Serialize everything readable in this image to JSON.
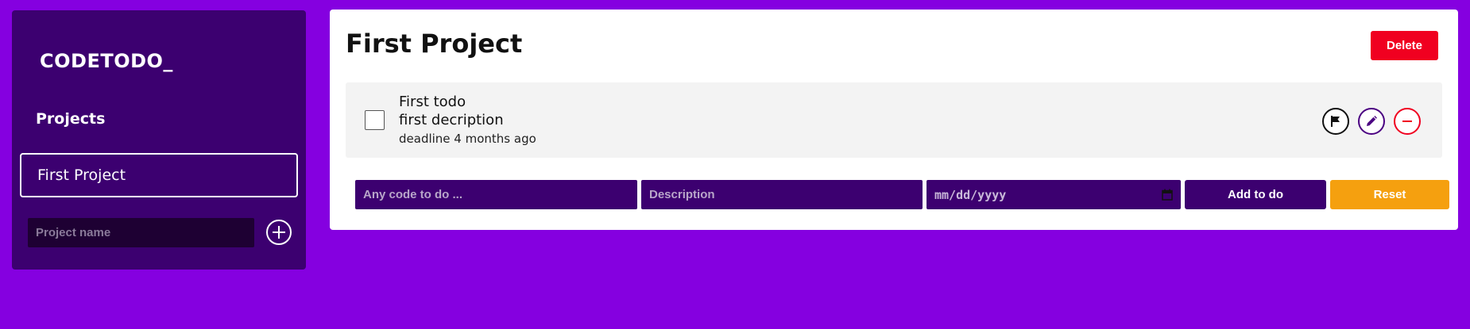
{
  "sidebar": {
    "logo": "CODETODO_",
    "projects_heading": "Projects",
    "projects": [
      {
        "label": "First Project"
      }
    ],
    "new_project_placeholder": "Project name",
    "add_icon": "plus-circle-icon"
  },
  "main": {
    "title": "First Project",
    "delete_label": "Delete",
    "todos": [
      {
        "title": "First todo",
        "description": "first decription",
        "deadline": "deadline 4 months ago",
        "checked": false,
        "actions": [
          "flag-icon",
          "pencil-icon",
          "minus-circle-icon"
        ]
      }
    ],
    "form": {
      "code_placeholder": "Any code to do ...",
      "description_placeholder": "Description",
      "date_placeholder": "mm/dd/yyyy",
      "add_label": "Add to do",
      "reset_label": "Reset"
    }
  },
  "colors": {
    "background": "#8500e0",
    "panel": "#3c0070",
    "delete": "#f00020",
    "reset": "#f5a00f"
  }
}
